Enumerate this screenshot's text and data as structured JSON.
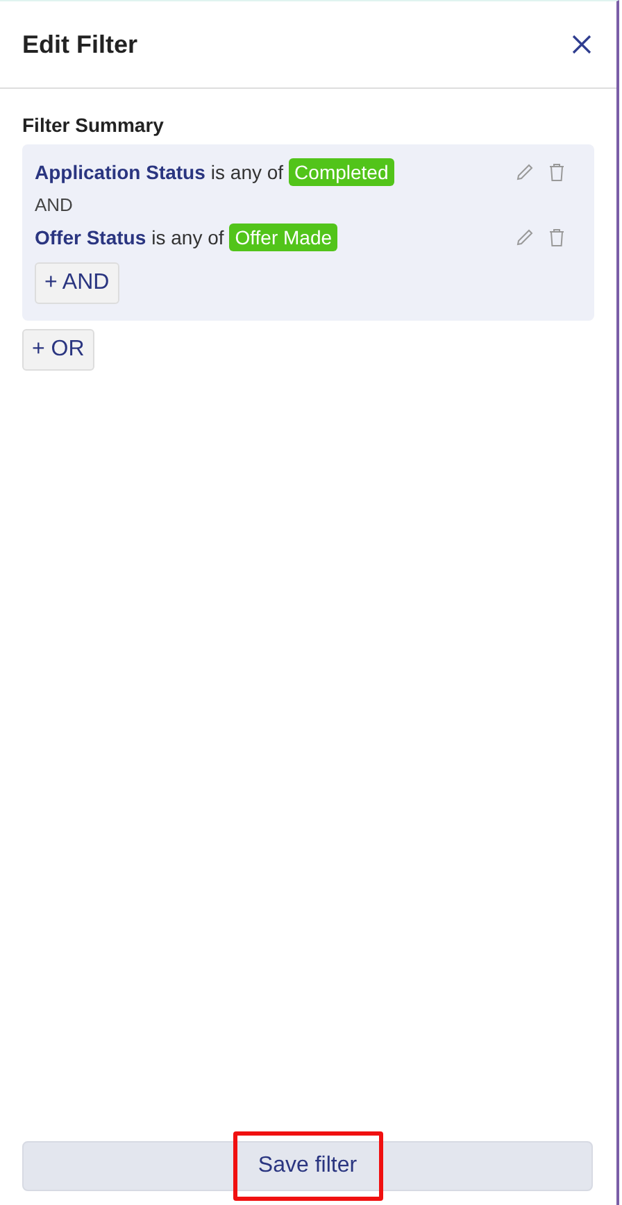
{
  "header": {
    "title": "Edit Filter"
  },
  "summary": {
    "title": "Filter Summary",
    "groups": [
      {
        "conditions": [
          {
            "field": "Application Status",
            "operator": "is any of",
            "values": [
              "Completed"
            ]
          },
          {
            "field": "Offer Status",
            "operator": "is any of",
            "values": [
              "Offer Made"
            ]
          }
        ],
        "joiner": "AND",
        "add_label": "+ AND"
      }
    ],
    "add_or_label": "+ OR"
  },
  "footer": {
    "save_label": "Save filter",
    "highlighted": true
  }
}
